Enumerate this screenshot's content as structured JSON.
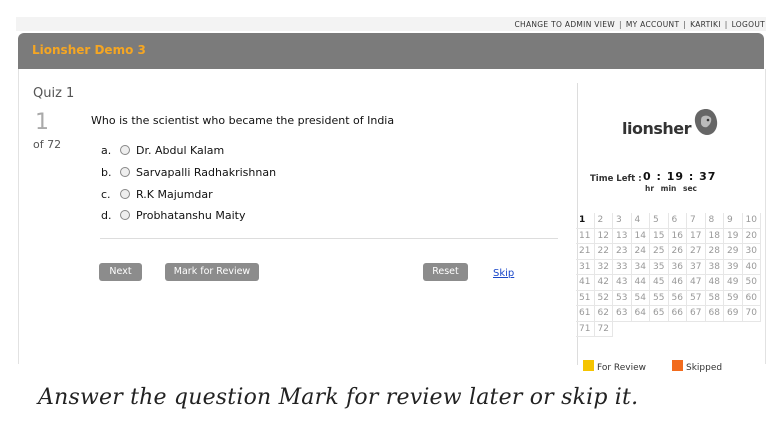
{
  "topnav": {
    "links": [
      "CHANGE TO ADMIN VIEW",
      "MY ACCOUNT",
      "KARTIKI",
      "LOGOUT"
    ]
  },
  "header": {
    "title": "Lionsher Demo 3"
  },
  "quiz": {
    "title": "Quiz 1",
    "current_number": "1",
    "of_total": "of 72",
    "question": "Who is the scientist who became the president of India",
    "options": [
      {
        "letter": "a.",
        "text": "Dr. Abdul Kalam"
      },
      {
        "letter": "b.",
        "text": "Sarvapalli Radhakrishnan"
      },
      {
        "letter": "c.",
        "text": "R.K Majumdar"
      },
      {
        "letter": "d.",
        "text": "Probhatanshu Maity"
      }
    ],
    "buttons": {
      "next": "Next",
      "mark_review": "Mark for Review",
      "reset": "Reset",
      "skip": "Skip"
    }
  },
  "sidebar": {
    "logo_text": "lionsher",
    "logo_icon": "lion-head-icon",
    "timer": {
      "label": "Time Left :",
      "value": "0 : 19 : 37",
      "units": "hr min sec"
    },
    "question_numbers": [
      "1",
      "2",
      "3",
      "4",
      "5",
      "6",
      "7",
      "8",
      "9",
      "10",
      "11",
      "12",
      "13",
      "14",
      "15",
      "16",
      "17",
      "18",
      "19",
      "20",
      "21",
      "22",
      "23",
      "24",
      "25",
      "26",
      "27",
      "28",
      "29",
      "30",
      "31",
      "32",
      "33",
      "34",
      "35",
      "36",
      "37",
      "38",
      "39",
      "40",
      "41",
      "42",
      "43",
      "44",
      "45",
      "46",
      "47",
      "48",
      "49",
      "50",
      "51",
      "52",
      "53",
      "54",
      "55",
      "56",
      "57",
      "58",
      "59",
      "60",
      "61",
      "62",
      "63",
      "64",
      "65",
      "66",
      "67",
      "68",
      "69",
      "70",
      "71",
      "72"
    ],
    "current_question": "1",
    "legend": {
      "for_review": "For Review",
      "skipped": "Skipped"
    },
    "colors": {
      "for_review": "#f5c400",
      "skipped": "#f26b1d"
    }
  },
  "caption": "Answer the question Mark for review later or skip it.",
  "colors": {
    "accent": "#f5a623",
    "header_bg": "#7b7b7b",
    "button_bg": "#8c8c8c"
  }
}
